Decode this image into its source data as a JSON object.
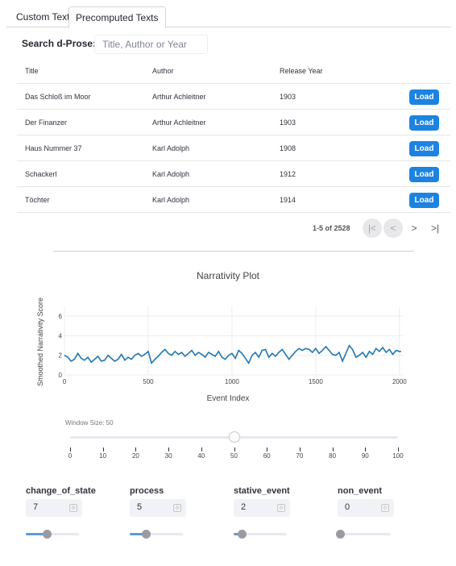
{
  "tabs": [
    {
      "label": "Custom Text"
    },
    {
      "label": "Precomputed Texts"
    }
  ],
  "search": {
    "label": "Search d-Prose:",
    "placeholder": "Title, Author or Year",
    "value": ""
  },
  "table": {
    "columns": [
      "Title",
      "Author",
      "Release Year"
    ],
    "rows": [
      {
        "title": "Das Schloß im Moor",
        "author": "Arthur Achleitner",
        "year": "1903",
        "action": "Load"
      },
      {
        "title": "Der Finanzer",
        "author": "Arthur Achleitner",
        "year": "1903",
        "action": "Load"
      },
      {
        "title": "Haus Nummer 37",
        "author": "Karl Adolph",
        "year": "1908",
        "action": "Load"
      },
      {
        "title": "Schackerl",
        "author": "Karl Adolph",
        "year": "1912",
        "action": "Load"
      },
      {
        "title": "Töchter",
        "author": "Karl Adolph",
        "year": "1914",
        "action": "Load"
      }
    ]
  },
  "pagination": {
    "text": "1-5 of 2528",
    "first_icon": "first-page-icon",
    "prev_icon": "prev-page-icon",
    "next_icon": "next-page-icon",
    "last_icon": "last-page-icon"
  },
  "chart_data": {
    "type": "line",
    "title": "Narrativity Plot",
    "xlabel": "Event Index",
    "ylabel": "Smoothed Narrativity Score",
    "xlim": [
      0,
      2020
    ],
    "ylim": [
      0,
      7
    ],
    "xticks": [
      "0",
      "500",
      "1000",
      "1500",
      "2000"
    ],
    "yticks": [
      "0",
      "2",
      "4",
      "6"
    ],
    "grid": true,
    "color": "#1f77b4",
    "series": [
      {
        "x": [
          0,
          20,
          40,
          60,
          80,
          100,
          120,
          140,
          160,
          180,
          200,
          220,
          240,
          260,
          280,
          300,
          320,
          340,
          360,
          380,
          400,
          420,
          440,
          460,
          480,
          500,
          520,
          540,
          560,
          580,
          600,
          620,
          640,
          660,
          680,
          700,
          720,
          740,
          760,
          780,
          800,
          820,
          840,
          860,
          880,
          900,
          920,
          940,
          960,
          980,
          1000,
          1020,
          1040,
          1060,
          1080,
          1100,
          1120,
          1140,
          1160,
          1180,
          1200,
          1220,
          1240,
          1260,
          1280,
          1300,
          1320,
          1340,
          1360,
          1380,
          1400,
          1420,
          1440,
          1460,
          1480,
          1500,
          1520,
          1540,
          1560,
          1580,
          1600,
          1620,
          1640,
          1660,
          1680,
          1700,
          1720,
          1740,
          1760,
          1780,
          1800,
          1820,
          1840,
          1860,
          1880,
          1900,
          1920,
          1940,
          1960,
          1980,
          2000,
          2010
        ],
        "values": [
          2.0,
          1.8,
          1.4,
          1.6,
          2.2,
          1.7,
          1.5,
          1.8,
          1.3,
          1.6,
          1.9,
          1.4,
          1.5,
          2.0,
          1.7,
          1.4,
          1.6,
          2.1,
          1.5,
          1.8,
          1.6,
          2.0,
          2.2,
          1.9,
          2.1,
          2.4,
          1.2,
          1.6,
          1.9,
          2.3,
          2.6,
          2.2,
          2.0,
          2.4,
          2.1,
          2.3,
          1.9,
          2.2,
          2.5,
          2.0,
          2.3,
          2.1,
          1.8,
          2.3,
          2.1,
          1.9,
          2.4,
          1.8,
          1.6,
          2.0,
          2.2,
          1.7,
          2.5,
          2.2,
          1.7,
          1.2,
          2.0,
          2.3,
          1.8,
          2.5,
          2.6,
          1.8,
          2.2,
          1.9,
          2.3,
          2.6,
          2.1,
          1.6,
          2.0,
          2.4,
          2.7,
          2.5,
          2.7,
          2.6,
          2.3,
          2.7,
          2.2,
          2.5,
          2.9,
          2.5,
          2.1,
          2.0,
          2.3,
          1.4,
          2.2,
          3.0,
          2.6,
          1.8,
          2.0,
          2.3,
          1.8,
          2.4,
          2.1,
          2.7,
          2.4,
          2.8,
          2.3,
          2.6,
          2.1,
          2.5,
          2.4,
          2.4
        ]
      }
    ]
  },
  "window_slider": {
    "label": "Window Size: 50",
    "value": 50,
    "min": 0,
    "max": 100,
    "ticks": [
      "0",
      "10",
      "20",
      "30",
      "40",
      "50",
      "60",
      "70",
      "80",
      "90",
      "100"
    ]
  },
  "params": [
    {
      "label": "change_of_state",
      "value": "7",
      "fraction": 0.35
    },
    {
      "label": "process",
      "value": "5",
      "fraction": 0.25
    },
    {
      "label": "stative_event",
      "value": "2",
      "fraction": 0.1
    },
    {
      "label": "non_event",
      "value": "0",
      "fraction": 0.0
    }
  ],
  "colors": {
    "accent": "#1c83e1",
    "line": "#1f77b4",
    "slider_fill": "#5a9be0"
  }
}
